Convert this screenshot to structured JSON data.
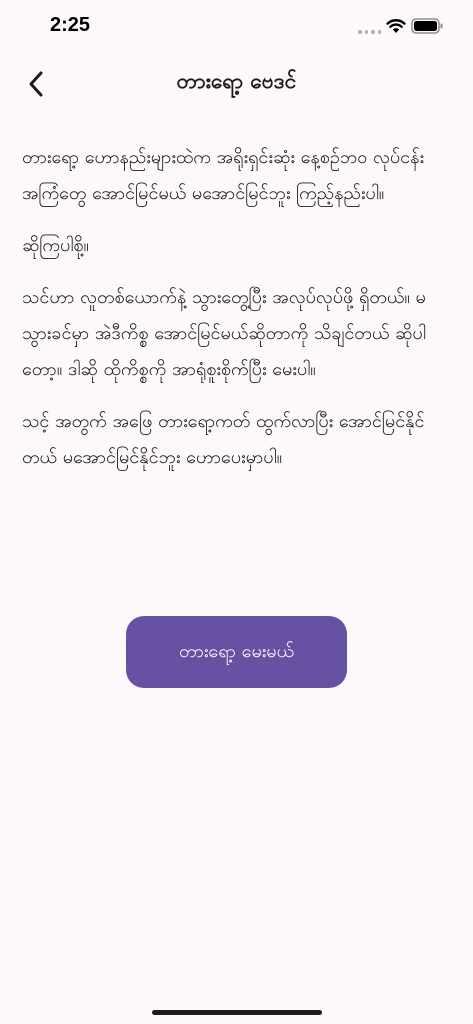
{
  "status_bar": {
    "time": "2:25"
  },
  "app_bar": {
    "title": "တားရော့ ဗေဒင်",
    "back_icon": "chevron-left-icon"
  },
  "content": {
    "paragraphs": [
      "တားရော့ ဟောနည်းများထဲက အရိုးရှင်းဆုံး နေ့စဥ်ဘဝ လုပ်ငန်းအကြံတွေ အောင်မြင်မယ် မအောင်မြင်ဘူး ကြည့်နည်းပါ။",
      "ဆိုကြပါစို့။",
      "သင်ဟာ လူတစ်ယောက်နဲ့ သွားတွေ့ပြီး အလုပ်လုပ်ဖို့ ရှိတယ်။ မသွားခင်မှာ အဲဒီကိစ္စ အောင်မြင်မယ်ဆိုတာကို သိချင်တယ် ဆိုပါတော့။ ဒါဆို ထိုကိစ္စကို အာရုံစူးစိုက်ပြီး မေးပါ။",
      "သင့် အတွက် အဖြေ တားရော့ကတ် ထွက်လာပြီး အောင်မြင်နိုင်တယ် မအောင်မြင်နိုင်ဘူး ဟောပေးမှာပါ။"
    ]
  },
  "action": {
    "ask_label": "တားရော့ မေးမယ်"
  },
  "colors": {
    "background": "#fdf8fc",
    "primary": "#6751a3",
    "on_primary": "#ffffff",
    "text": "#1d1b1e"
  }
}
